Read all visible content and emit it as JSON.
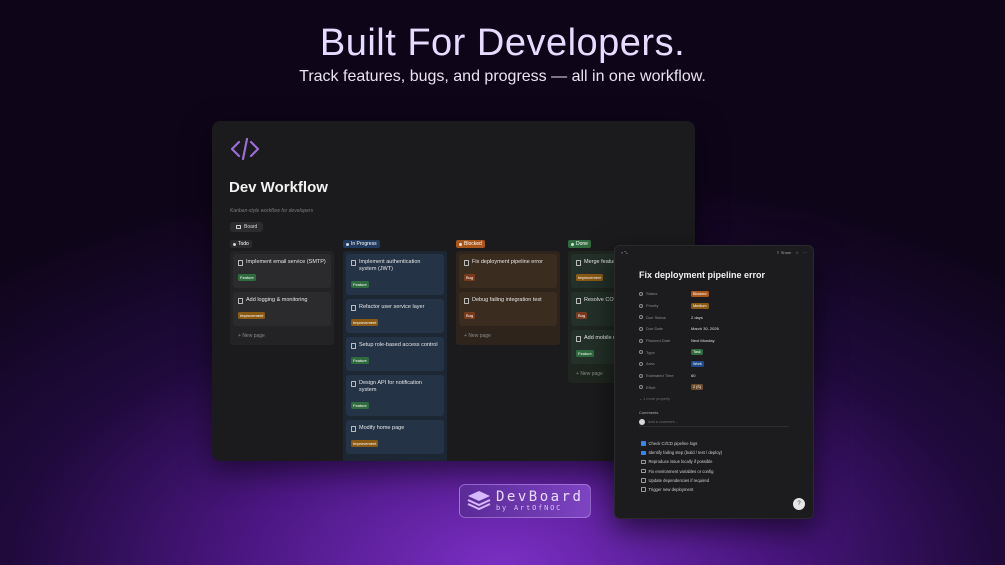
{
  "hero": {
    "title": "Built For Developers.",
    "subtitle": "Track features, bugs, and progress — all in one workflow."
  },
  "page": {
    "icon": "code-brackets-icon",
    "title": "Dev Workflow",
    "description": "Kanban-style workflow for developers",
    "view_tab": "Board"
  },
  "columns": [
    {
      "name": "Todo",
      "color": "#2a2a2c",
      "cards": [
        {
          "title": "Implement email service (SMTP)",
          "tag": "Feature",
          "tag_type": "feature"
        },
        {
          "title": "Add logging & monitoring",
          "tag": "Improvement",
          "tag_type": "improvement"
        }
      ],
      "new_page": "New page"
    },
    {
      "name": "In Progress",
      "color": "#1f3a5c",
      "cards": [
        {
          "title": "Implement authentication system (JWT)",
          "tag": "Feature",
          "tag_type": "feature"
        },
        {
          "title": "Refactor user service layer",
          "tag": "Improvement",
          "tag_type": "improvement"
        },
        {
          "title": "Setup role-based access control",
          "tag": "Feature",
          "tag_type": "feature"
        },
        {
          "title": "Design API for notification system",
          "tag": "Feature",
          "tag_type": "feature"
        },
        {
          "title": "Modify home page",
          "tag": "Improvement",
          "tag_type": "improvement"
        }
      ],
      "new_page": "New page"
    },
    {
      "name": "Blocked",
      "color": "#a8561a",
      "cards": [
        {
          "title": "Fix deployment pipeline error",
          "tag": "Bug",
          "tag_type": "bug"
        },
        {
          "title": "Debug failing integration test",
          "tag": "Bug",
          "tag_type": "bug"
        }
      ],
      "new_page": "New page"
    },
    {
      "name": "Done",
      "color": "#2f6b3f",
      "cards": [
        {
          "title": "Merge feature b",
          "tag": "Improvement",
          "tag_type": "improvement"
        },
        {
          "title": "Resolve CORS is",
          "tag": "Bug",
          "tag_type": "bug"
        },
        {
          "title": "Add mobile resp",
          "tag": "Feature",
          "tag_type": "feature"
        }
      ],
      "new_page": "New page"
    }
  ],
  "detail": {
    "toolbar_share": "Share",
    "title": "Fix deployment pipeline error",
    "properties": [
      {
        "name": "Status",
        "value": "Blocked",
        "pill_color": "#a8561a"
      },
      {
        "name": "Priority",
        "value": "Medium",
        "pill_color": "#8a5a14"
      },
      {
        "name": "Due Status",
        "value": "2 days",
        "pill_color": ""
      },
      {
        "name": "Due Date",
        "value": "March 30, 2026",
        "pill_color": ""
      },
      {
        "name": "Planned Date",
        "value": "Next Monday",
        "pill_color": ""
      },
      {
        "name": "Type",
        "value": "Task",
        "pill_color": "#2f6b3f"
      },
      {
        "name": "Area",
        "value": "Work",
        "pill_color": "#1f4a8a"
      },
      {
        "name": "Estimated Time",
        "value": "60",
        "pill_color": ""
      },
      {
        "name": "Effort",
        "value": "2 (S)",
        "pill_color": "#6b4a2a"
      }
    ],
    "more_properties": "1 more property",
    "comments_label": "Comments",
    "comment_placeholder": "Add a comment...",
    "todos": [
      {
        "text": "Check CI/CD pipeline logs",
        "done": true
      },
      {
        "text": "Identify failing step (build / test / deploy)",
        "done": true
      },
      {
        "text": "Reproduce issue locally if possible",
        "done": false
      },
      {
        "text": "Fix environment variables or config",
        "done": false
      },
      {
        "text": "Update dependencies if required",
        "done": false
      },
      {
        "text": "Trigger new deployment",
        "done": false
      }
    ]
  },
  "logo": {
    "name": "DevBoard",
    "byline": "by ArtOfNOC"
  }
}
